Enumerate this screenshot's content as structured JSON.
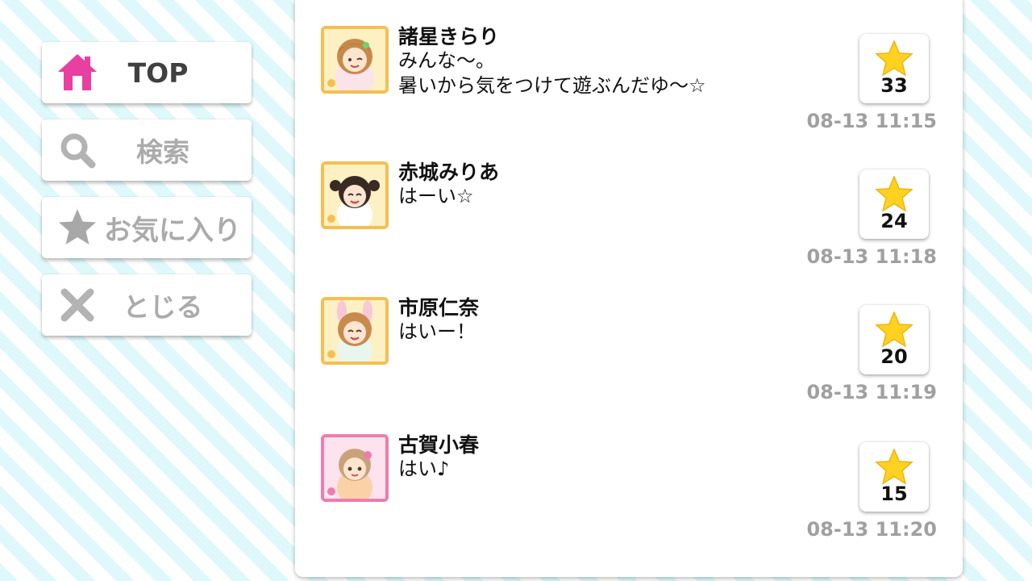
{
  "menu": {
    "items": [
      {
        "label": "TOP",
        "icon": "home-icon",
        "active": true,
        "color": "#e83fa1"
      },
      {
        "label": "検索",
        "icon": "search-icon",
        "active": false
      },
      {
        "label": "お気に入り",
        "icon": "star-icon",
        "active": false
      },
      {
        "label": "とじる",
        "icon": "close-icon",
        "active": false
      }
    ]
  },
  "posts": [
    {
      "name": "諸星きらり",
      "lines": [
        "みんな〜。",
        "暑いから気をつけて遊ぶんだゆ〜☆"
      ],
      "likes": "33",
      "time": "08-13 11:15",
      "frame_color": "#f4bf52"
    },
    {
      "name": "赤城みりあ",
      "lines": [
        "はーい☆"
      ],
      "likes": "24",
      "time": "08-13 11:18",
      "frame_color": "#f4bf52"
    },
    {
      "name": "市原仁奈",
      "lines": [
        "はいー！"
      ],
      "likes": "20",
      "time": "08-13 11:19",
      "frame_color": "#f4bf52"
    },
    {
      "name": "古賀小春",
      "lines": [
        "はい♪"
      ],
      "likes": "15",
      "time": "08-13 11:20",
      "frame_color": "#f07bb0"
    }
  ],
  "colors": {
    "accent_pink": "#e83fa1",
    "star_yellow": "#ffd21f",
    "timestamp_gray": "#a0a0a0",
    "stripe_cyan": "#dff8fb"
  }
}
